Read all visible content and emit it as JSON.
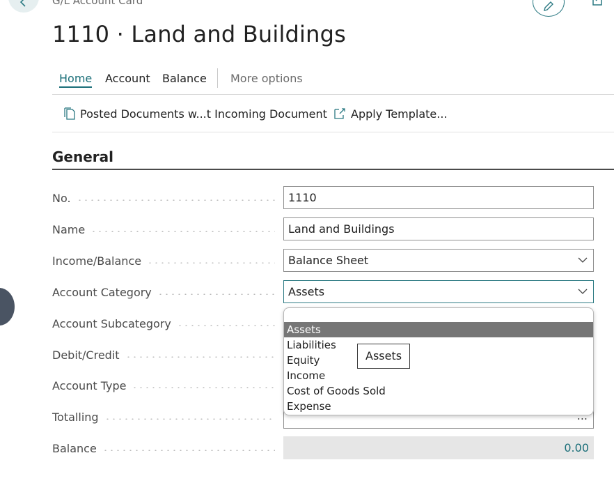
{
  "header": {
    "caption": "G/L Account Card",
    "title": "1110 · Land and Buildings"
  },
  "menu": {
    "tabs": [
      {
        "label": "Home",
        "active": true
      },
      {
        "label": "Account",
        "active": false
      },
      {
        "label": "Balance",
        "active": false
      }
    ],
    "more": "More options"
  },
  "actions": [
    {
      "label": "Posted Documents w...t Incoming Document",
      "icon": "document-icon"
    },
    {
      "label": "Apply Template...",
      "icon": "apply-template-icon"
    }
  ],
  "section": {
    "title": "General"
  },
  "fields": {
    "no": {
      "label": "No.",
      "value": "1110"
    },
    "name": {
      "label": "Name",
      "value": "Land and Buildings"
    },
    "income_balance": {
      "label": "Income/Balance",
      "value": "Balance Sheet"
    },
    "account_category": {
      "label": "Account Category",
      "value": "Assets"
    },
    "account_subcategory": {
      "label": "Account Subcategory"
    },
    "debit_credit": {
      "label": "Debit/Credit"
    },
    "account_type": {
      "label": "Account Type"
    },
    "totalling": {
      "label": "Totalling",
      "ellipsis": "..."
    },
    "balance": {
      "label": "Balance",
      "value": "0.00"
    }
  },
  "dropdown": {
    "options": [
      "",
      "Assets",
      "Liabilities",
      "Equity",
      "Income",
      "Cost of Goods Sold",
      "Expense"
    ],
    "selected": "Assets"
  },
  "tooltip": {
    "text": "Assets"
  },
  "colors": {
    "accent": "#1b6f79",
    "selected_option": "#767676"
  }
}
